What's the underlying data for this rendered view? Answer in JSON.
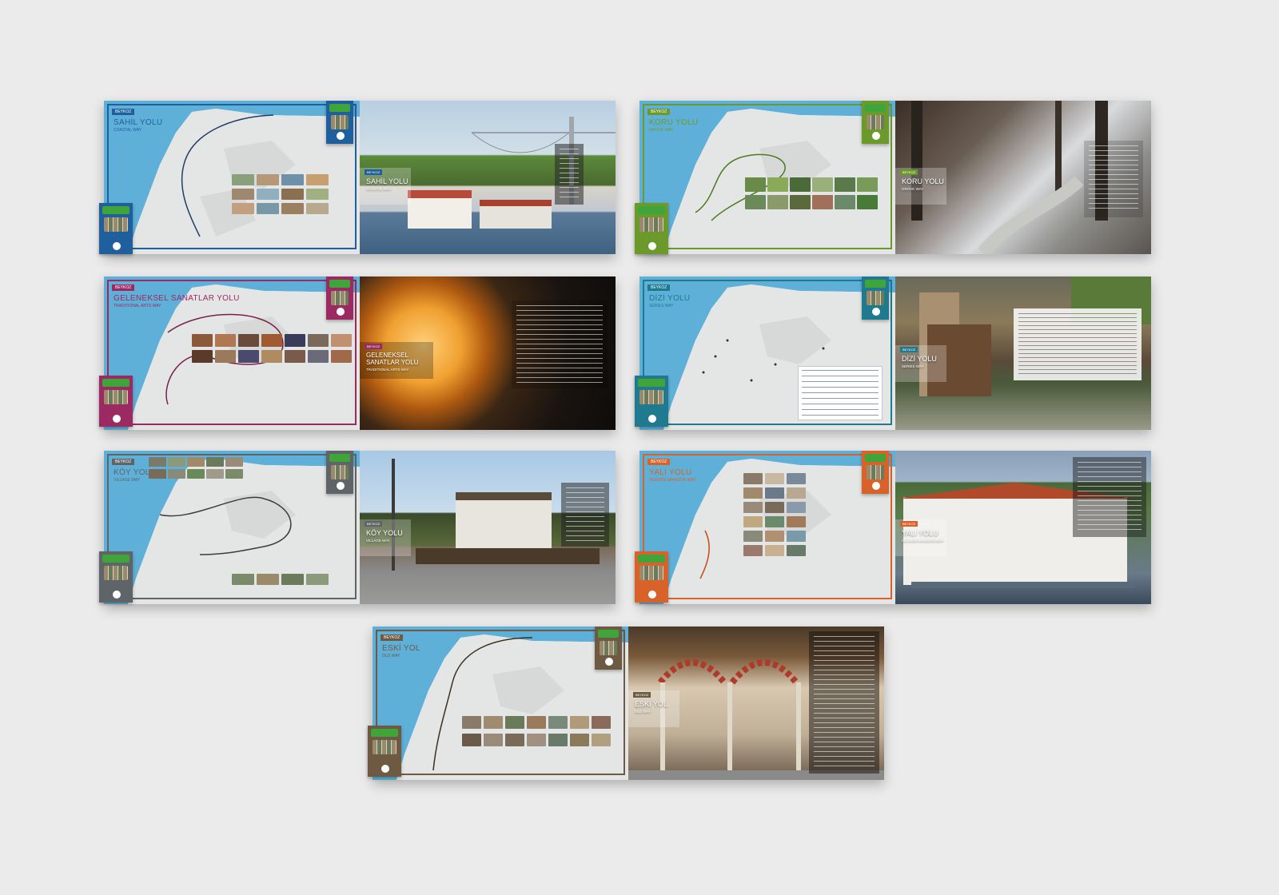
{
  "spreads": [
    {
      "id": "sahil",
      "tag": "BEYKOZ",
      "title": "SAHİL YOLU",
      "subtitle": "COASTAL WAY",
      "photo_title": "SAHİL YOLU",
      "photo_subtitle": "COASTAL WAY",
      "accent": "#1f5f9e"
    },
    {
      "id": "koru",
      "tag": "BEYKOZ",
      "title": "KORU YOLU",
      "subtitle": "GROVE WAY",
      "photo_title": "KORU YOLU",
      "photo_subtitle": "GROVE WAY",
      "accent": "#6b9a2b"
    },
    {
      "id": "geleneksel",
      "tag": "BEYKOZ",
      "title": "GELENEKSEL SANATLAR YOLU",
      "subtitle": "TRADITIONAL ARTS WAY",
      "photo_title": "GELENEKSEL SANATLAR YOLU",
      "photo_subtitle": "TRADITIONAL ARTS WAY",
      "accent": "#9c2a62"
    },
    {
      "id": "dizi",
      "tag": "BEYKOZ",
      "title": "DİZİ YOLU",
      "subtitle": "SERIES WAY",
      "photo_title": "DİZİ YOLU",
      "photo_subtitle": "SERIES WAY",
      "accent": "#1f7a8f"
    },
    {
      "id": "koy",
      "tag": "BEYKOZ",
      "title": "KÖY YOLU",
      "subtitle": "VILLAGE WAY",
      "photo_title": "KÖY YOLU",
      "photo_subtitle": "VILLAGE WAY",
      "accent": "#5f6468"
    },
    {
      "id": "yali",
      "tag": "BEYKOZ",
      "title": "YALI YOLU",
      "subtitle": "SEASIDE MANSION WAY",
      "photo_title": "YALI YOLU",
      "photo_subtitle": "SEASIDE MANSION WAY",
      "accent": "#d9622b"
    },
    {
      "id": "eski",
      "tag": "BEYKOZ",
      "title": "ESKİ YOL",
      "subtitle": "OLD WAY",
      "photo_title": "ESKİ YOL",
      "photo_subtitle": "OLD WAY",
      "accent": "#6e5a43"
    }
  ]
}
